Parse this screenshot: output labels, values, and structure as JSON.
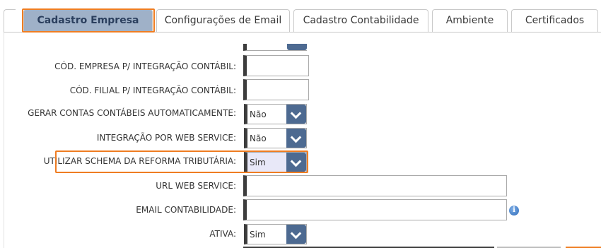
{
  "tabs": [
    {
      "label": "Cadastro Empresa",
      "active": true
    },
    {
      "label": "Configurações de Email",
      "active": false
    },
    {
      "label": "Cadastro Contabilidade",
      "active": false
    },
    {
      "label": "Ambiente",
      "active": false
    },
    {
      "label": "Certificados",
      "active": false
    }
  ],
  "form": {
    "cod_empresa": {
      "label": "CÓD. EMPRESA P/ INTEGRAÇÃO CONTÁBIL:",
      "value": ""
    },
    "cod_filial": {
      "label": "CÓD. FILIAL P/ INTEGRAÇÃO CONTÁBIL:",
      "value": ""
    },
    "gerar_contas": {
      "label": "GERAR CONTAS CONTÁBEIS AUTOMATICAMENTE:",
      "value": "Não"
    },
    "integracao_ws": {
      "label": "INTEGRAÇÃO POR WEB SERVICE:",
      "value": "Não"
    },
    "reforma_tributaria": {
      "label": "UTILIZAR SCHEMA DA REFORMA TRIBUTÁRIA:",
      "value": "Sim"
    },
    "url_ws": {
      "label": "URL WEB SERVICE:",
      "value": ""
    },
    "email_contabilidade": {
      "label": "EMAIL CONTABILIDADE:",
      "value": ""
    },
    "ativa": {
      "label": "ATIVA:",
      "value": "Sim"
    }
  },
  "info_icon_glyph": "i",
  "colors": {
    "highlight": "#ef7d22",
    "active_tab_bg": "#9fb1c8",
    "select_button": "#4d6a91",
    "selected_bg": "#e8e8f8"
  }
}
